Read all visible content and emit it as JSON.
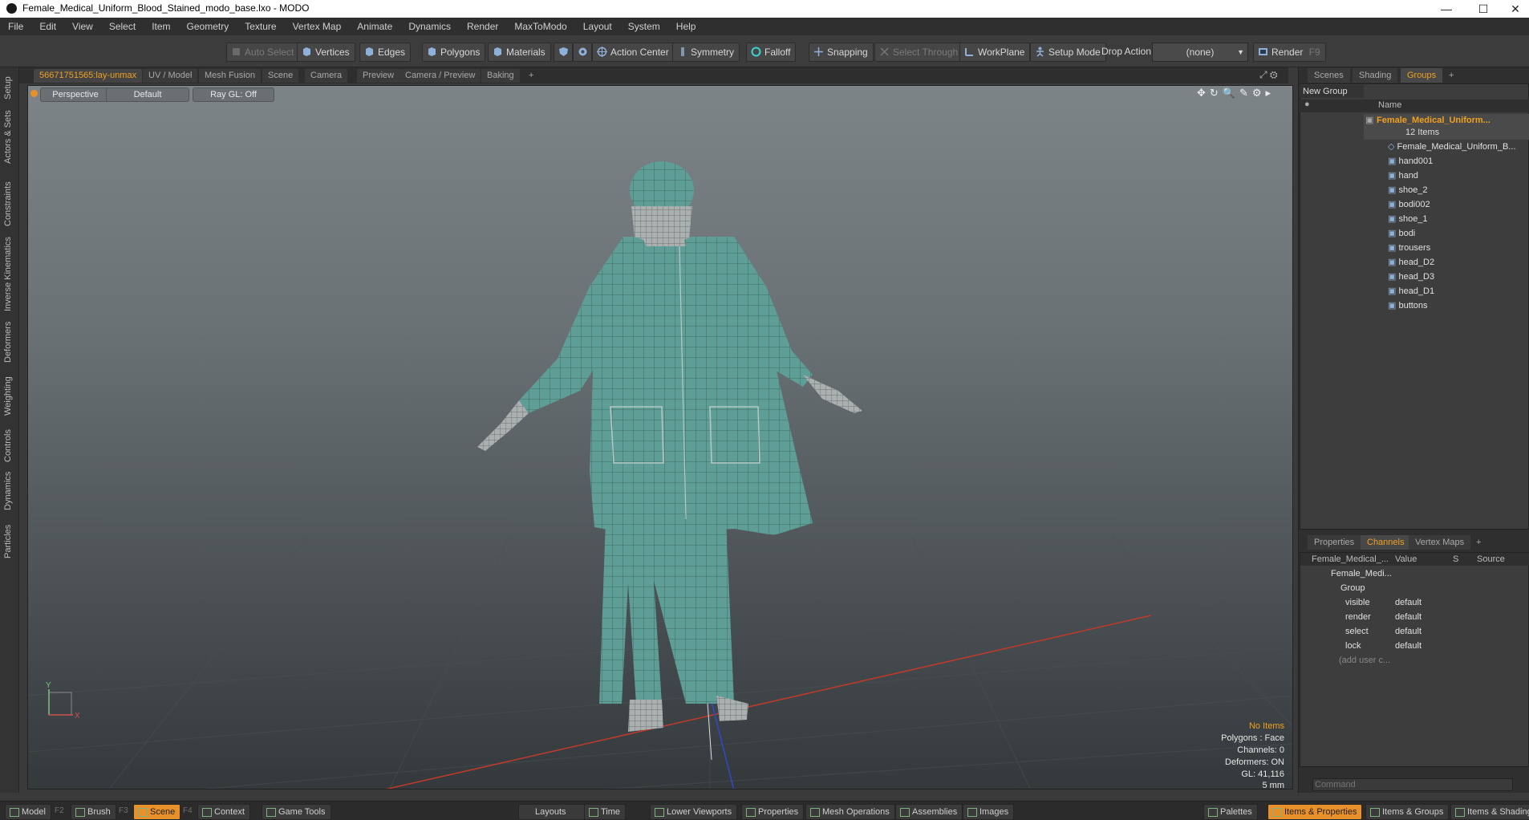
{
  "window": {
    "title": "Female_Medical_Uniform_Blood_Stained_modo_base.lxo - MODO",
    "minimize": "—",
    "maximize": "☐",
    "close": "✕"
  },
  "menu": [
    "File",
    "Edit",
    "View",
    "Select",
    "Item",
    "Geometry",
    "Texture",
    "Vertex Map",
    "Animate",
    "Dynamics",
    "Render",
    "MaxToModo",
    "Layout",
    "System",
    "Help"
  ],
  "toolbar": {
    "auto_select": "Auto Select",
    "vertices": "Vertices",
    "edges": "Edges",
    "polygons": "Polygons",
    "materials": "Materials",
    "action_center": "Action Center",
    "symmetry": "Symmetry",
    "falloff": "Falloff",
    "snapping": "Snapping",
    "select_through": "Select Through",
    "workplane": "WorkPlane",
    "setup_mode": "Setup Mode",
    "drop_action": "Drop Action",
    "drop_value": "(none)",
    "render": "Render",
    "render_key": "F9"
  },
  "left_tabs": [
    "Setup",
    "Actors & Sets",
    "Constraints",
    "Inverse Kinematics",
    "Deformers",
    "Weighting",
    "Controls",
    "Dynamics",
    "Particles"
  ],
  "viewport_tabs": [
    "56671751565:lay-unmax",
    "UV / Model",
    "Mesh Fusion",
    "Scene",
    "Camera",
    "Preview",
    "Camera / Preview",
    "Baking",
    "+"
  ],
  "viewport": {
    "view": "Perspective",
    "shading": "Default",
    "raygl": "Ray GL: Off",
    "info": {
      "items": "No Items",
      "polygons": "Polygons : Face",
      "channels": "Channels: 0",
      "deformers": "Deformers: ON",
      "gl": "GL: 41,116",
      "unit": "5 mm"
    },
    "axis_y": "Y",
    "axis_x": "X"
  },
  "groups_panel": {
    "tabs": [
      "Scenes",
      "Shading",
      "Groups",
      "+"
    ],
    "new_group": "New Group",
    "col_name": "Name",
    "group_name": "Female_Medical_Uniform...",
    "group_count": "12 Items",
    "items": [
      "Female_Medical_Uniform_B...",
      "hand001",
      "hand",
      "shoe_2",
      "bodi002",
      "shoe_1",
      "bodi",
      "trousers",
      "head_D2",
      "head_D3",
      "head_D1",
      "buttons"
    ]
  },
  "channels_panel": {
    "tabs": [
      "Properties",
      "Channels",
      "Vertex Maps",
      "+"
    ],
    "col_item": "Female_Medical_...",
    "col_value": "Value",
    "col_s": "S",
    "col_source": "Source",
    "root": "Female_Medi...",
    "group": "Group",
    "rows": [
      {
        "name": "visible",
        "value": "default"
      },
      {
        "name": "render",
        "value": "default"
      },
      {
        "name": "select",
        "value": "default"
      },
      {
        "name": "lock",
        "value": "default"
      }
    ],
    "add_user": "(add user c...",
    "command_placeholder": "Command"
  },
  "statusbar": {
    "model": "Model",
    "model_key": "F2",
    "brush": "Brush",
    "brush_key": "F3",
    "scene": "Scene",
    "scene_key": "F4",
    "context": "Context",
    "game_tools": "Game Tools",
    "layouts": "Layouts",
    "time": "Time",
    "lower_viewports": "Lower Viewports",
    "properties": "Properties",
    "mesh_operations": "Mesh Operations",
    "assemblies": "Assemblies",
    "images": "Images",
    "palettes": "Palettes",
    "items_properties": "Items & Properties",
    "items_groups": "Items & Groups",
    "items_shading": "Items & Shading"
  },
  "colors": {
    "accent": "#f0a020",
    "mesh": "#5e9e96",
    "xaxis": "#c23a2a",
    "zaxis": "#3048d0"
  }
}
